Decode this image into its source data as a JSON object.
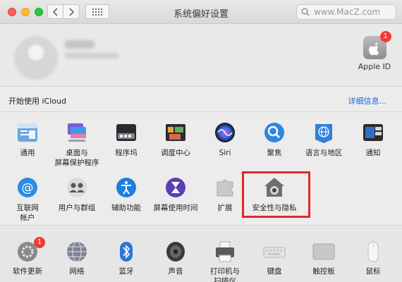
{
  "window": {
    "title": "系统偏好设置",
    "search_text": "www.MacZ.com"
  },
  "account": {
    "apple_id_label": "Apple ID",
    "apple_id_badge": "1"
  },
  "icloud": {
    "prompt": "开始使用 iCloud",
    "details_link": "详细信息..."
  },
  "row1": [
    {
      "label": "通用",
      "icon": "general-icon"
    },
    {
      "label": "桌面与\n屏幕保护程序",
      "icon": "desktop-screensaver-icon"
    },
    {
      "label": "程序坞",
      "icon": "dock-icon"
    },
    {
      "label": "调度中心",
      "icon": "mission-control-icon"
    },
    {
      "label": "Siri",
      "icon": "siri-icon"
    },
    {
      "label": "聚焦",
      "icon": "spotlight-icon"
    },
    {
      "label": "语言与地区",
      "icon": "language-region-icon"
    },
    {
      "label": "通知",
      "icon": "notifications-icon"
    }
  ],
  "row2": [
    {
      "label": "互联网\n帐户",
      "icon": "internet-accounts-icon"
    },
    {
      "label": "用户与群组",
      "icon": "users-groups-icon"
    },
    {
      "label": "辅助功能",
      "icon": "accessibility-icon"
    },
    {
      "label": "屏幕使用时间",
      "icon": "screen-time-icon"
    },
    {
      "label": "扩展",
      "icon": "extensions-icon"
    },
    {
      "label": "安全性与隐私",
      "icon": "security-privacy-icon"
    }
  ],
  "row3": [
    {
      "label": "软件更新",
      "icon": "software-update-icon",
      "badge": "1"
    },
    {
      "label": "网络",
      "icon": "network-icon"
    },
    {
      "label": "蓝牙",
      "icon": "bluetooth-icon"
    },
    {
      "label": "声音",
      "icon": "sound-icon"
    },
    {
      "label": "打印机与\n扫描仪",
      "icon": "printers-scanners-icon"
    },
    {
      "label": "键盘",
      "icon": "keyboard-icon"
    },
    {
      "label": "触控板",
      "icon": "trackpad-icon"
    },
    {
      "label": "鼠标",
      "icon": "mouse-icon"
    }
  ],
  "colors": {
    "highlight": "#e3262a",
    "link": "#1a66d1",
    "badge": "#ef3b36"
  }
}
